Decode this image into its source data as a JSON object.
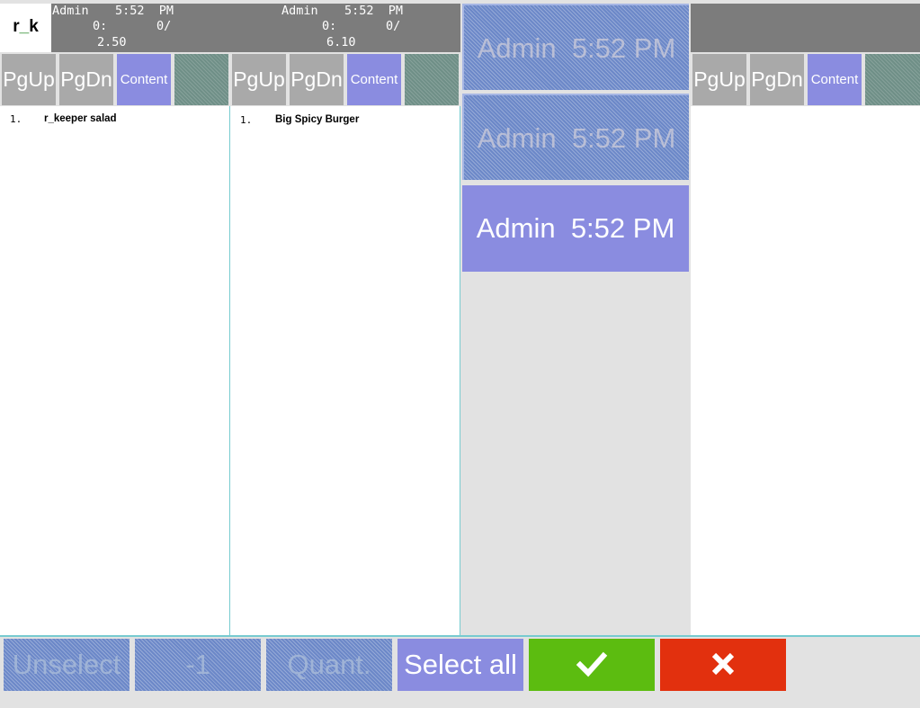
{
  "app": {
    "logo_prefix": "r",
    "logo_underscore": "_",
    "logo_suffix": "k"
  },
  "orders": [
    {
      "user": "Admin",
      "time": "5:52  PM",
      "line2a": "0:",
      "line2b": "0/",
      "total": "2.50",
      "items": [
        {
          "num": "1.",
          "name": "r_keeper salad"
        }
      ]
    },
    {
      "user": "Admin",
      "time": "5:52  PM",
      "line2a": "0:",
      "line2b": "0/",
      "total": "6.10",
      "items": [
        {
          "num": "1.",
          "name": "Big Spicy Burger"
        }
      ]
    }
  ],
  "nav": {
    "pgup": "PgUp",
    "pgdn": "PgDn",
    "content": "Content"
  },
  "order_cards": [
    {
      "label": "Admin  5:52 PM",
      "state": "disabled"
    },
    {
      "label": "Admin  5:52 PM",
      "state": "disabled"
    },
    {
      "label": "Admin  5:52 PM",
      "state": "active"
    }
  ],
  "footer": {
    "unselect": "Unselect",
    "minus_one": "-1",
    "quant": "Quant.",
    "select_all": "Select all",
    "confirm_icon": "check-icon",
    "cancel_icon": "close-icon"
  },
  "colors": {
    "header_bg": "#7c7c7c",
    "button_gray": "#a9a9a9",
    "accent_purple": "#8a8ce0",
    "confirm_green": "#5cbc10",
    "cancel_red": "#e2300e",
    "disabled_blue": "#6c88c8"
  }
}
